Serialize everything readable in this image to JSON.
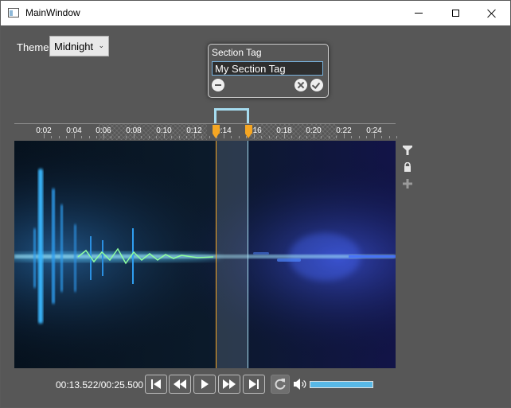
{
  "window": {
    "title": "MainWindow",
    "controls": {
      "minimize": "minimize-icon",
      "maximize": "maximize-icon",
      "close": "close-icon"
    }
  },
  "theme": {
    "label": "Theme",
    "selected": "Midnight"
  },
  "section_popup": {
    "title": "Section Tag",
    "input_value": "My Section Tag",
    "buttons": [
      "remove-icon",
      "cancel-icon",
      "confirm-icon"
    ]
  },
  "timeline": {
    "tick_labels": [
      "0:02",
      "0:04",
      "0:06",
      "0:08",
      "0:10",
      "0:12",
      "0:14",
      "0:16",
      "0:18",
      "0:20",
      "0:22",
      "0:24"
    ],
    "duration_seconds": 25.5,
    "selection_start_seconds": 13.0,
    "selection_end_seconds": 15.2,
    "colors": {
      "start_marker": "#f5a623",
      "end_marker": "#f5a623",
      "bracket": "#a6dcf0"
    }
  },
  "side_tools": [
    "funnel-icon",
    "lock-icon",
    "plus-icon"
  ],
  "player": {
    "time": "00:13.522/00:25.500",
    "volume_percent": 100,
    "buttons": [
      "skip-start-icon",
      "rewind-icon",
      "play-icon",
      "fast-forward-icon",
      "skip-end-icon",
      "loop-icon"
    ],
    "accent": "#58b8e6"
  }
}
